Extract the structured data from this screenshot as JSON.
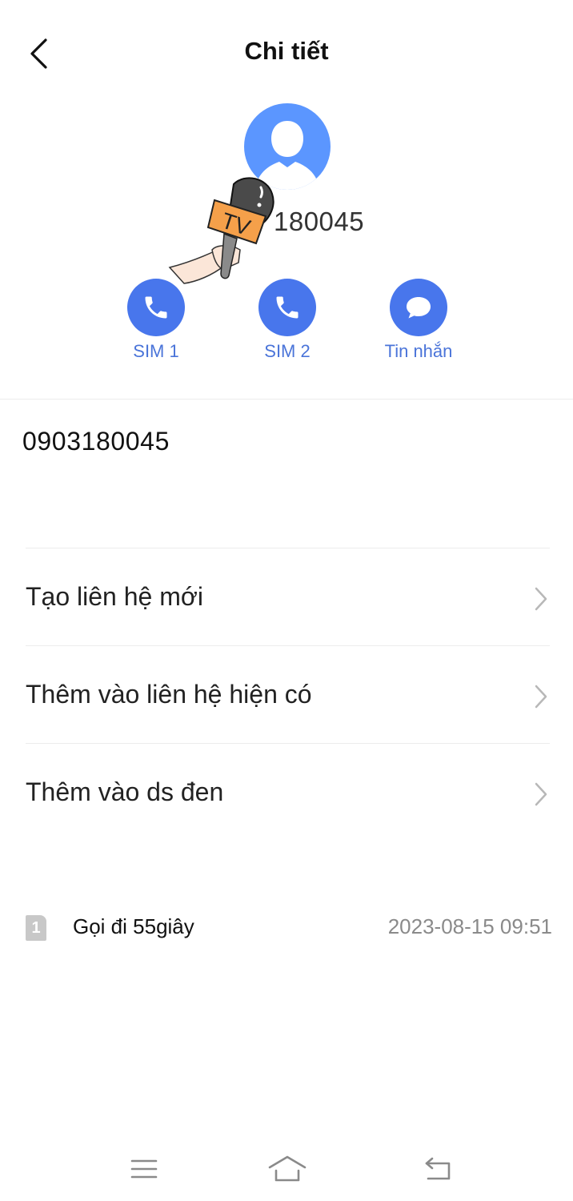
{
  "header": {
    "title": "Chi tiết",
    "back_icon": "back-arrow-icon"
  },
  "contact": {
    "avatar_icon": "person-silhouette-icon",
    "number_heading": "180045",
    "phone_number": "0903180045"
  },
  "sticker": {
    "icon": "tv-microphone-sticker",
    "text": "TV"
  },
  "actions": [
    {
      "label": "SIM 1",
      "icon": "phone-icon"
    },
    {
      "label": "SIM 2",
      "icon": "phone-icon"
    },
    {
      "label": "Tin nhắn",
      "icon": "message-bubble-icon"
    }
  ],
  "menu": [
    {
      "label": "Tạo liên hệ mới",
      "icon": "chevron-right-icon"
    },
    {
      "label": "Thêm vào liên hệ hiện có",
      "icon": "chevron-right-icon"
    },
    {
      "label": "Thêm vào ds đen",
      "icon": "chevron-right-icon"
    }
  ],
  "call_log": {
    "sim_badge": "1",
    "description": "Gọi đi 55giây",
    "timestamp": "2023-08-15 09:51"
  },
  "navbar": {
    "menu_icon": "menu-icon",
    "home_icon": "home-icon",
    "back_icon": "return-icon"
  },
  "colors": {
    "accent": "#4876ec",
    "avatar_bg": "#5b96ff",
    "label_blue": "#4a74d9",
    "muted": "#8a8a8a"
  }
}
